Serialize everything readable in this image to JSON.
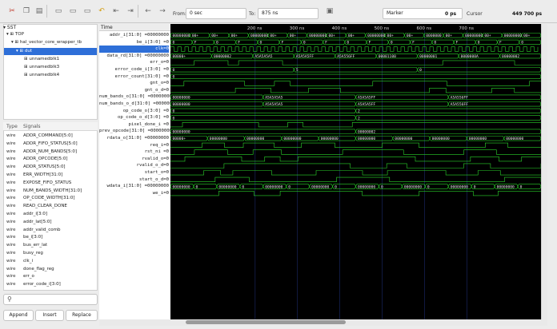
{
  "toolbar": {
    "from_label": "From:",
    "from_value": "0 sec",
    "to_label": "To:",
    "to_value": "875 ns",
    "marker_label": "Marker",
    "marker_value": "0 ps",
    "cursor_label": "Cursor",
    "cursor_value": "449 700 ps",
    "icons": [
      "cut-icon",
      "copy-icon",
      "paste-icon",
      "select-all-icon",
      "zoom-fit-icon",
      "zoom-in-icon",
      "zoom-out-icon",
      "undo-icon",
      "first-icon",
      "last-icon",
      "back-icon",
      "forward-icon",
      "reload-icon"
    ]
  },
  "sst": {
    "title": "SST",
    "items": [
      {
        "label": "TOP"
      },
      {
        "label": "hal_vector_core_wrapper_tb"
      },
      {
        "label": "dut"
      },
      {
        "label": "unnamedblk1"
      },
      {
        "label": "unnamedblk3"
      },
      {
        "label": "unnamedblk4"
      }
    ]
  },
  "signals_panel": {
    "type_header": "Type",
    "signals_header": "Signals",
    "rows": [
      {
        "type": "wire",
        "name": "ADDR_COMMAND[5:0]"
      },
      {
        "type": "wire",
        "name": "ADDR_FIFO_STATUS[5:0]"
      },
      {
        "type": "wire",
        "name": "ADDR_NUM_BANDS[5:0]"
      },
      {
        "type": "wire",
        "name": "ADDR_OPCODE[5:0]"
      },
      {
        "type": "wire",
        "name": "ADDR_STATUS[5:0]"
      },
      {
        "type": "wire",
        "name": "ERR_WIDTH[31:0]"
      },
      {
        "type": "wire",
        "name": "EXPOSE_FIFO_STATUS"
      },
      {
        "type": "wire",
        "name": "NUM_BANDS_WIDTH[31:0]"
      },
      {
        "type": "wire",
        "name": "OP_CODE_WIDTH[31:0]"
      },
      {
        "type": "wire",
        "name": "READ_CLEAR_DONE"
      },
      {
        "type": "wire",
        "name": "addr_i[3:0]"
      },
      {
        "type": "wire",
        "name": "addr_lat[5:0]"
      },
      {
        "type": "wire",
        "name": "addr_valid_comb"
      },
      {
        "type": "wire",
        "name": "be_i[3:0]"
      },
      {
        "type": "wire",
        "name": "bus_err_lat"
      },
      {
        "type": "wire",
        "name": "busy_reg"
      },
      {
        "type": "wire",
        "name": "clk_i"
      },
      {
        "type": "wire",
        "name": "done_flag_reg"
      },
      {
        "type": "wire",
        "name": "err_o"
      },
      {
        "type": "wire",
        "name": "error_code_i[3:0]"
      }
    ],
    "buttons": {
      "append": "Append",
      "insert": "Insert",
      "replace": "Replace"
    }
  },
  "waves": {
    "time_header": "Time",
    "ticks": [
      "200 ns",
      "300 ns",
      "400 ns",
      "500 ns",
      "600 ns",
      "700 ns"
    ],
    "tick_ns": [
      200,
      300,
      400,
      500,
      600,
      700
    ],
    "range_ns": [
      0,
      875
    ],
    "signals": [
      {
        "name": "addr_i[31:0] =00000000",
        "kind": "bus"
      },
      {
        "name": "be_i[3:0] =0",
        "kind": "bus"
      },
      {
        "name": "clk=0",
        "kind": "clk",
        "selected": true
      },
      {
        "name": "data_rd[31:0] =00000000",
        "kind": "bus"
      },
      {
        "name": "err_o=0",
        "kind": "bit"
      },
      {
        "name": "error_code_i[3:0] =0",
        "kind": "bus"
      },
      {
        "name": "error_count[31:0] =0",
        "kind": "bus"
      },
      {
        "name": "gnt_o=0",
        "kind": "bit"
      },
      {
        "name": "gnt_o_d=0",
        "kind": "bit"
      },
      {
        "name": "num_bands_o[31:0] =00000000",
        "kind": "bus"
      },
      {
        "name": "num_bands_o_d[31:0] =00000000",
        "kind": "bus"
      },
      {
        "name": "op_code_o[3:0] =0",
        "kind": "bus"
      },
      {
        "name": "op_code_o_d[3:0] =0",
        "kind": "bus"
      },
      {
        "name": "pixel_done_i =0",
        "kind": "bit"
      },
      {
        "name": "prev_opcode[31:0] =00000000",
        "kind": "bus"
      },
      {
        "name": "rdata_o[31:0] =00000000",
        "kind": "bus"
      },
      {
        "name": "req_i=0",
        "kind": "bit"
      },
      {
        "name": "rst_ni =0",
        "kind": "bit"
      },
      {
        "name": "rvalid_o=0",
        "kind": "bit"
      },
      {
        "name": "rvalid_o_d=0",
        "kind": "bit"
      },
      {
        "name": "start_o=0",
        "kind": "bit"
      },
      {
        "name": "start_o_d=0",
        "kind": "bit"
      },
      {
        "name": "wdata_i[31:0] =00000000",
        "kind": "bus"
      },
      {
        "name": "we_i=0",
        "kind": "bit"
      }
    ],
    "bus_labels": {
      "addr": [
        "00000000",
        "00+",
        "00+",
        "00+",
        "00000000",
        "00+",
        "00+",
        "00000000",
        "00+",
        "00+",
        "00000000",
        "00+",
        "00+",
        "0000000",
        "00+",
        "00000000",
        "00+",
        "00000000",
        "00+"
      ],
      "be": [
        "0",
        "F",
        "0",
        "F",
        "0",
        "F",
        "0",
        "F",
        "0",
        "F",
        "0",
        "F",
        "0",
        "F",
        "0",
        "F",
        "0"
      ],
      "data_rd": [
        "00000+",
        "00000002",
        "A5A5A5A5",
        "A5A5A5FF",
        "A5A556FF",
        "00001100",
        "00000001",
        "0000000A",
        "00000002"
      ],
      "error_code": [
        "0",
        "5",
        "0"
      ],
      "num_bands_o": [
        "00000000",
        "A5A5A5A5",
        "A5A5A5FF",
        "A5A556FF"
      ],
      "num_bands_o_d": [
        "00000000",
        "A5A5A5A5",
        "A5A5A5FF",
        "A5A556FF"
      ],
      "op_code_o": [
        "0",
        "2"
      ],
      "op_code_o_d": [
        "0",
        "2"
      ],
      "prev_opcode": [
        "00000000",
        "00000002"
      ],
      "rdata": [
        "00000+",
        "00000000",
        "00000000",
        "00000000",
        "00000000",
        "00000000",
        "00000000",
        "00000000",
        "00000000",
        "00000000"
      ],
      "wdata": [
        "00000000",
        "0",
        "00000000",
        "0",
        "00000000",
        "0",
        "00000000",
        "0",
        "00000000",
        "0",
        "00000000",
        "0",
        "00000000",
        "0",
        "00000000",
        "0"
      ]
    }
  }
}
